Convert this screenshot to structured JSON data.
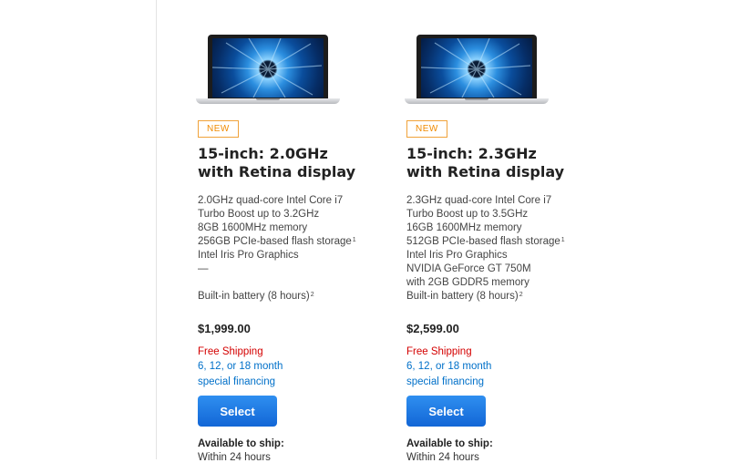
{
  "products": [
    {
      "badge": "NEW",
      "title_line1": "15-inch: 2.0GHz",
      "title_line2": "with Retina display",
      "specs": [
        "2.0GHz quad-core Intel Core i7",
        "Turbo Boost up to 3.2GHz",
        "8GB 1600MHz memory",
        "256GB PCIe-based flash storage",
        "Intel Iris Pro Graphics",
        "—",
        ""
      ],
      "storage_footnote": "1",
      "battery": "Built-in battery (8 hours)",
      "battery_footnote": "2",
      "price": "$1,999.00",
      "shipping": "Free Shipping",
      "financing_line1": "6, 12, or 18 month",
      "financing_line2": "special financing",
      "select_label": "Select",
      "availability_label": "Available to ship:",
      "availability_value": "Within 24 hours"
    },
    {
      "badge": "NEW",
      "title_line1": "15-inch: 2.3GHz",
      "title_line2": "with Retina display",
      "specs": [
        "2.3GHz quad-core Intel Core i7",
        "Turbo Boost up to 3.5GHz",
        "16GB 1600MHz memory",
        "512GB PCIe-based flash storage",
        "Intel Iris Pro Graphics",
        "NVIDIA GeForce GT 750M",
        "with 2GB GDDR5 memory"
      ],
      "storage_footnote": "1",
      "battery": "Built-in battery (8 hours)",
      "battery_footnote": "2",
      "price": "$2,599.00",
      "shipping": "Free Shipping",
      "financing_line1": "6, 12, or 18 month",
      "financing_line2": "special financing",
      "select_label": "Select",
      "availability_label": "Available to ship:",
      "availability_value": "Within 24 hours"
    }
  ],
  "colors": {
    "badge": "#f08a00",
    "shipping": "#d40000",
    "link": "#0070c9",
    "button": "#1a75e0"
  }
}
